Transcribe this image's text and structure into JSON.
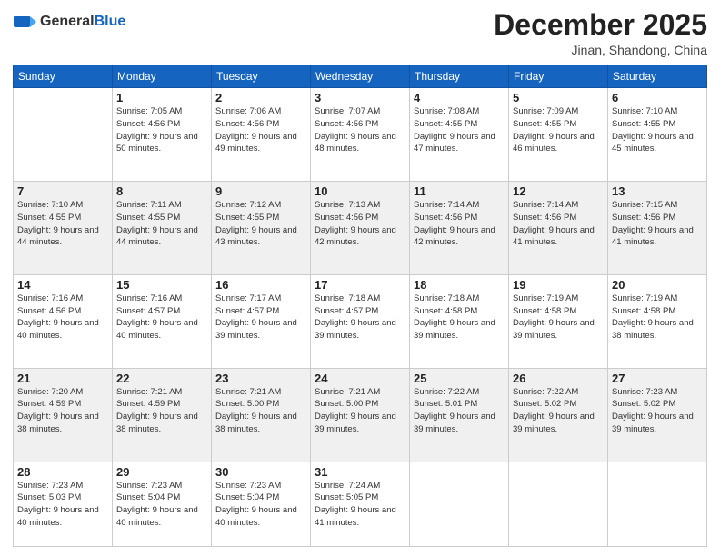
{
  "header": {
    "logo_general": "General",
    "logo_blue": "Blue",
    "title": "December 2025",
    "location": "Jinan, Shandong, China"
  },
  "days_of_week": [
    "Sunday",
    "Monday",
    "Tuesday",
    "Wednesday",
    "Thursday",
    "Friday",
    "Saturday"
  ],
  "weeks": [
    [
      {
        "day": "",
        "empty": true
      },
      {
        "day": "1",
        "sunrise": "7:05 AM",
        "sunset": "4:56 PM",
        "daylight": "9 hours and 50 minutes."
      },
      {
        "day": "2",
        "sunrise": "7:06 AM",
        "sunset": "4:56 PM",
        "daylight": "9 hours and 49 minutes."
      },
      {
        "day": "3",
        "sunrise": "7:07 AM",
        "sunset": "4:56 PM",
        "daylight": "9 hours and 48 minutes."
      },
      {
        "day": "4",
        "sunrise": "7:08 AM",
        "sunset": "4:55 PM",
        "daylight": "9 hours and 47 minutes."
      },
      {
        "day": "5",
        "sunrise": "7:09 AM",
        "sunset": "4:55 PM",
        "daylight": "9 hours and 46 minutes."
      },
      {
        "day": "6",
        "sunrise": "7:10 AM",
        "sunset": "4:55 PM",
        "daylight": "9 hours and 45 minutes."
      }
    ],
    [
      {
        "day": "7",
        "sunrise": "7:10 AM",
        "sunset": "4:55 PM",
        "daylight": "9 hours and 44 minutes."
      },
      {
        "day": "8",
        "sunrise": "7:11 AM",
        "sunset": "4:55 PM",
        "daylight": "9 hours and 44 minutes."
      },
      {
        "day": "9",
        "sunrise": "7:12 AM",
        "sunset": "4:55 PM",
        "daylight": "9 hours and 43 minutes."
      },
      {
        "day": "10",
        "sunrise": "7:13 AM",
        "sunset": "4:56 PM",
        "daylight": "9 hours and 42 minutes."
      },
      {
        "day": "11",
        "sunrise": "7:14 AM",
        "sunset": "4:56 PM",
        "daylight": "9 hours and 42 minutes."
      },
      {
        "day": "12",
        "sunrise": "7:14 AM",
        "sunset": "4:56 PM",
        "daylight": "9 hours and 41 minutes."
      },
      {
        "day": "13",
        "sunrise": "7:15 AM",
        "sunset": "4:56 PM",
        "daylight": "9 hours and 41 minutes."
      }
    ],
    [
      {
        "day": "14",
        "sunrise": "7:16 AM",
        "sunset": "4:56 PM",
        "daylight": "9 hours and 40 minutes."
      },
      {
        "day": "15",
        "sunrise": "7:16 AM",
        "sunset": "4:57 PM",
        "daylight": "9 hours and 40 minutes."
      },
      {
        "day": "16",
        "sunrise": "7:17 AM",
        "sunset": "4:57 PM",
        "daylight": "9 hours and 39 minutes."
      },
      {
        "day": "17",
        "sunrise": "7:18 AM",
        "sunset": "4:57 PM",
        "daylight": "9 hours and 39 minutes."
      },
      {
        "day": "18",
        "sunrise": "7:18 AM",
        "sunset": "4:58 PM",
        "daylight": "9 hours and 39 minutes."
      },
      {
        "day": "19",
        "sunrise": "7:19 AM",
        "sunset": "4:58 PM",
        "daylight": "9 hours and 39 minutes."
      },
      {
        "day": "20",
        "sunrise": "7:19 AM",
        "sunset": "4:58 PM",
        "daylight": "9 hours and 38 minutes."
      }
    ],
    [
      {
        "day": "21",
        "sunrise": "7:20 AM",
        "sunset": "4:59 PM",
        "daylight": "9 hours and 38 minutes."
      },
      {
        "day": "22",
        "sunrise": "7:21 AM",
        "sunset": "4:59 PM",
        "daylight": "9 hours and 38 minutes."
      },
      {
        "day": "23",
        "sunrise": "7:21 AM",
        "sunset": "5:00 PM",
        "daylight": "9 hours and 38 minutes."
      },
      {
        "day": "24",
        "sunrise": "7:21 AM",
        "sunset": "5:00 PM",
        "daylight": "9 hours and 39 minutes."
      },
      {
        "day": "25",
        "sunrise": "7:22 AM",
        "sunset": "5:01 PM",
        "daylight": "9 hours and 39 minutes."
      },
      {
        "day": "26",
        "sunrise": "7:22 AM",
        "sunset": "5:02 PM",
        "daylight": "9 hours and 39 minutes."
      },
      {
        "day": "27",
        "sunrise": "7:23 AM",
        "sunset": "5:02 PM",
        "daylight": "9 hours and 39 minutes."
      }
    ],
    [
      {
        "day": "28",
        "sunrise": "7:23 AM",
        "sunset": "5:03 PM",
        "daylight": "9 hours and 40 minutes."
      },
      {
        "day": "29",
        "sunrise": "7:23 AM",
        "sunset": "5:04 PM",
        "daylight": "9 hours and 40 minutes."
      },
      {
        "day": "30",
        "sunrise": "7:23 AM",
        "sunset": "5:04 PM",
        "daylight": "9 hours and 40 minutes."
      },
      {
        "day": "31",
        "sunrise": "7:24 AM",
        "sunset": "5:05 PM",
        "daylight": "9 hours and 41 minutes."
      },
      {
        "day": "",
        "empty": true
      },
      {
        "day": "",
        "empty": true
      },
      {
        "day": "",
        "empty": true
      }
    ]
  ],
  "labels": {
    "sunrise_prefix": "Sunrise: ",
    "sunset_prefix": "Sunset: ",
    "daylight_prefix": "Daylight: "
  }
}
